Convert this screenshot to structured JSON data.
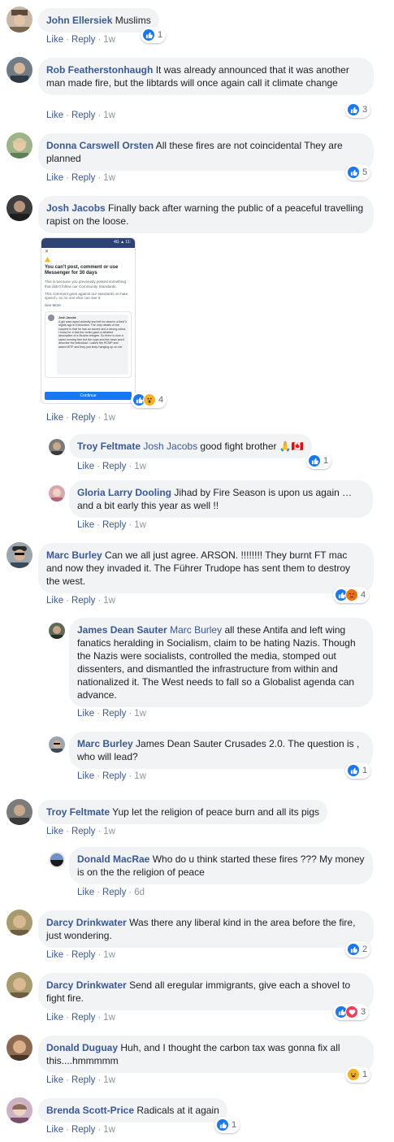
{
  "actions": {
    "like": "Like",
    "reply": "Reply"
  },
  "colors": {
    "link": "#385898",
    "bubble": "#f2f3f5",
    "like": "#1877f2",
    "love": "#f33e58",
    "angry": "#e9710f",
    "haha": "#f7b125"
  },
  "comments": [
    {
      "author": "John Ellersiek",
      "text": "Muslims",
      "time": "1w",
      "reactions": [
        "like"
      ],
      "count": "1"
    },
    {
      "author": "Rob Featherstonhaugh",
      "text": "It was already announced that it was another man made fire, but the libtards will once again call it climate change",
      "time": "1w",
      "reactions": [
        "like"
      ],
      "count": "3"
    },
    {
      "author": "Donna Carswell Orsten",
      "text": "All these fires are not coincidental They are planned",
      "time": "1w",
      "reactions": [
        "like"
      ],
      "count": "5"
    },
    {
      "author": "Josh Jacobs",
      "text": "Finally back after warning the public of a peaceful travelling rapist on the loose.",
      "time": "1w",
      "reactions": [
        "like",
        "wow"
      ],
      "count": "4",
      "attachment": {
        "status": "4G ▲ 11:",
        "close": "✕",
        "heading": "You can't post, comment or use Messenger for 30 days",
        "reason": "This is because you previously posted something that didn't follow our Community Standards.",
        "detail": "This comment goes against our standards on hate speech, so no one else can see it.",
        "see_more": "See More",
        "inner_author": "Josh Jacobs",
        "inner_text": "A girl was raped violently and left for dead in a field 3 nights ago in Edmonton. The only details of the suspect is that he has an accent and a strong odour. I know for a fact the victim gave a detailed description of a Muslim refugee. So there is now a rapist running free but the cops and the news won't describe the individual. I called the RCMP and asked WTF and they just keep hanging up on me.",
        "button": "Continue"
      }
    },
    {
      "author": "Troy Feltmate",
      "mention": "Josh Jacobs",
      "text": "good fight brother",
      "emoji": "🙏🇨🇦",
      "time": "1w",
      "reactions": [
        "like"
      ],
      "count": "1"
    },
    {
      "author": "Gloria Larry Dooling",
      "text": "Jihad by Fire Season is upon us again … and a bit early this year as well !!",
      "time": "1w"
    },
    {
      "author": "Marc Burley",
      "text": "Can we all just agree. ARSON. !!!!!!!! They burnt FT mac and now they invaded it. The Führer Trudope has sent them to destroy the west.",
      "time": "1w",
      "reactions": [
        "like",
        "angry"
      ],
      "count": "4"
    },
    {
      "author": "James Dean Sauter",
      "mention": "Marc Burley",
      "text": "all these Antifa and left wing fanatics heralding in Socialism, claim to be hating Nazis. Though the Nazis were socialists, controlled the media, stomped out dissenters, and dismantled the infrastructure from within and nationalized it. The West needs to fall so a Globalist agenda can advance.",
      "time": "1w"
    },
    {
      "author": "Marc Burley",
      "text": "James Dean Sauter Crusades 2.0. The question is , who will lead?",
      "time": "1w",
      "reactions": [
        "like"
      ],
      "count": "1"
    },
    {
      "author": "Troy Feltmate",
      "text": "Yup let the religion of peace burn and all its pigs",
      "time": "1w"
    },
    {
      "author": "Donald MacRae",
      "text": "Who do u think started these fires ??? My money is on the the religion of peace",
      "time": "6d"
    },
    {
      "author": "Darcy Drinkwater",
      "text": "Was there any liberal kind in the area before the fire, just wondering.",
      "time": "1w",
      "reactions": [
        "like"
      ],
      "count": "2"
    },
    {
      "author": "Darcy Drinkwater",
      "text": "Send all eregular immigrants, give each a shovel to fight fire.",
      "time": "1w",
      "reactions": [
        "like",
        "love"
      ],
      "count": "3"
    },
    {
      "author": "Donald Duguay",
      "text": "Huh, and I thought the carbon tax was gonna fix all this....hmmmmm",
      "time": "1w",
      "reactions": [
        "haha"
      ],
      "count": "1"
    },
    {
      "author": "Brenda Scott-Price",
      "text": "Radicals at it again",
      "time": "1w",
      "reactions": [
        "like"
      ],
      "count": "1"
    }
  ]
}
